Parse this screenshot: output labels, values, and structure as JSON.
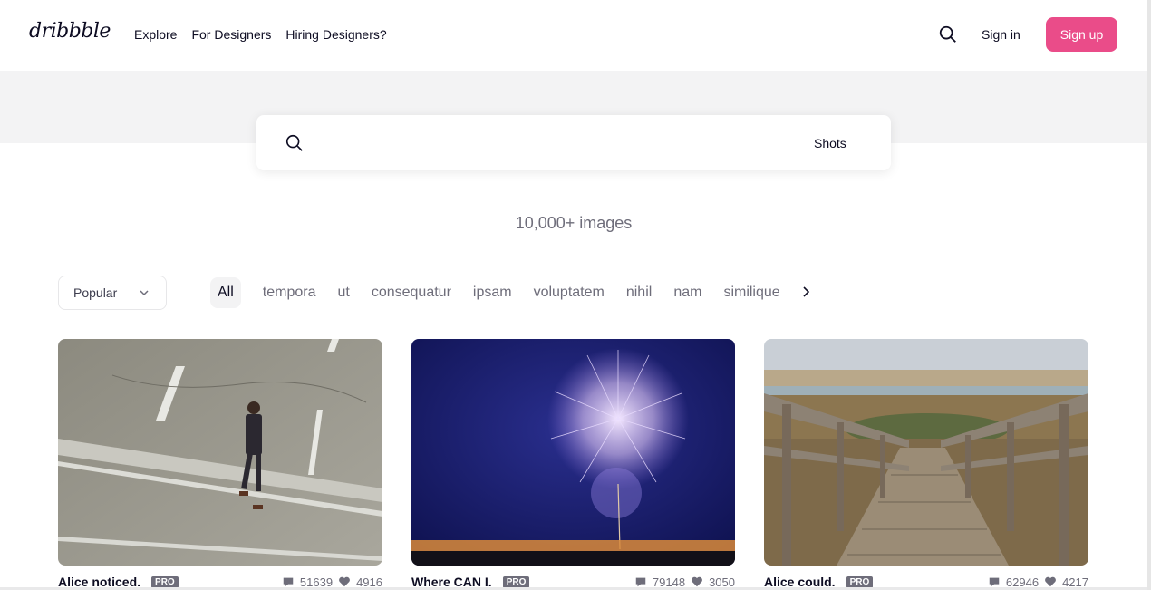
{
  "header": {
    "logo": "dribbble",
    "nav": [
      "Explore",
      "For Designers",
      "Hiring Designers?"
    ],
    "signin": "Sign in",
    "signup": "Sign up"
  },
  "search": {
    "placeholder": "",
    "scope": "Shots"
  },
  "results": {
    "count_label": "10,000+ images"
  },
  "filters": {
    "sort": "Popular",
    "tags": [
      "All",
      "tempora",
      "ut",
      "consequatur",
      "ipsam",
      "voluptatem",
      "nihil",
      "nam",
      "similique"
    ]
  },
  "cards": [
    {
      "title": "Alice noticed.",
      "badge": "PRO",
      "comments": "51639",
      "likes": "4916",
      "image": "man-walking-on-road"
    },
    {
      "title": "Where CAN I.",
      "badge": "PRO",
      "comments": "79148",
      "likes": "3050",
      "image": "fireworks-night"
    },
    {
      "title": "Alice could.",
      "badge": "PRO",
      "comments": "62946",
      "likes": "4217",
      "image": "wooden-boardwalk"
    }
  ],
  "colors": {
    "brand": "#ea4c89",
    "text": "#0d0c22",
    "muted": "#6e6d7a"
  }
}
